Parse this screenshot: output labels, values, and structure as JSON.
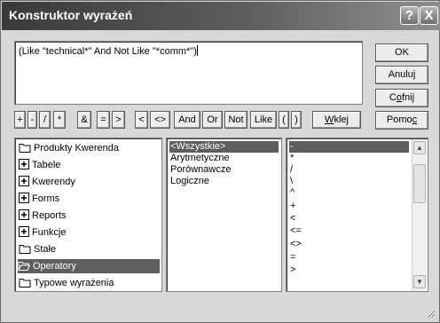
{
  "window": {
    "title": "Konstruktor wyrażeń",
    "help_label": "?",
    "close_label": "X"
  },
  "expression": {
    "value": "(Like \"technical*\" And Not Like \"*comm*\")"
  },
  "buttons": {
    "ok": "OK",
    "cancel": "Anuluj",
    "undo_pre": "C",
    "undo_accel": "o",
    "undo_post": "fnij",
    "help_pre": "Pomo",
    "help_accel": "c",
    "paste_accel": "W",
    "paste_post": "klej"
  },
  "operators": [
    "+",
    "-",
    "/",
    "*",
    "&",
    "=",
    ">",
    "<",
    "<>",
    "And",
    "Or",
    "Not",
    "Like",
    "(",
    ")"
  ],
  "tree": [
    {
      "label": "Produkty Kwerenda",
      "icon": "folder-icon"
    },
    {
      "label": "Tabele",
      "icon": "plus-box-icon"
    },
    {
      "label": "Kwerendy",
      "icon": "plus-box-icon"
    },
    {
      "label": "Forms",
      "icon": "plus-box-icon"
    },
    {
      "label": "Reports",
      "icon": "plus-box-icon"
    },
    {
      "label": "Funkcje",
      "icon": "plus-box-icon"
    },
    {
      "label": "Stałe",
      "icon": "folder-icon"
    },
    {
      "label": "Operatory",
      "icon": "open-folder-icon",
      "selected": true
    },
    {
      "label": "Typowe wyrażenia",
      "icon": "folder-icon"
    }
  ],
  "categories": [
    "<Wszystkie>",
    "Arytmetyczne",
    "Porównawcze",
    "Logiczne"
  ],
  "values": [
    "-",
    "*",
    "/",
    "\\",
    "^",
    "+",
    "<",
    "<=",
    "<>",
    "=",
    ">"
  ],
  "colors": {
    "selection": "#5e5e5e",
    "titlebar_dark": "#3a3a3a",
    "face": "#d8d8d8"
  }
}
